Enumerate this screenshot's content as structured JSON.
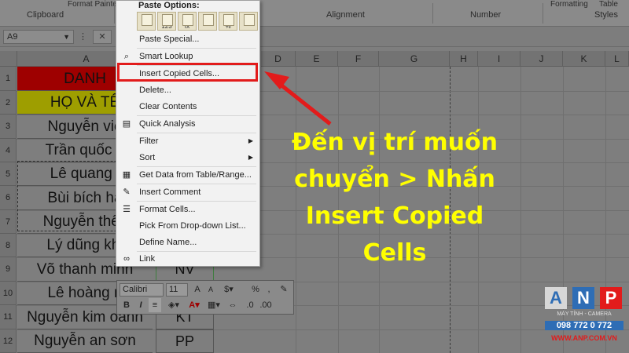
{
  "ribbon": {
    "clipboard": "Clipboard",
    "format_painter": "Format Painter",
    "alignment": "Alignment",
    "number": "Number",
    "formatting": "Formatting",
    "table": "Table",
    "styles": "Styles"
  },
  "formula_bar": {
    "name_box": "A9"
  },
  "columns": [
    "A",
    "D",
    "E",
    "F",
    "G",
    "H",
    "I",
    "J",
    "K",
    "L"
  ],
  "rows": [
    "1",
    "2",
    "3",
    "4",
    "5",
    "6",
    "7",
    "8",
    "9",
    "10",
    "11",
    "12"
  ],
  "cells_a": [
    "DANH",
    "HỌ VÀ TÊ",
    "Nguyễn việ",
    "Trần quốc b",
    "Lê quang l",
    "Bùi bích hằ",
    "Nguyễn thế l",
    "Lý dũng khi",
    "Võ thanh minh",
    "Lê hoàng n",
    "Nguyễn kim oanh",
    "Nguyễn an sơn"
  ],
  "cells_b": {
    "r9": "NV",
    "r11": "KT",
    "r12": "PP"
  },
  "context_menu": {
    "paste_options": "Paste Options:",
    "paste_icons": [
      "paste-icon",
      "paste-values-icon",
      "paste-formulas-icon",
      "paste-transpose-icon",
      "paste-formatting-icon",
      "paste-link-icon"
    ],
    "paste_icon_labels": [
      "",
      "123",
      "fx",
      "",
      "%",
      ""
    ],
    "items": [
      {
        "label": "Paste Special...",
        "icon": ""
      },
      {
        "label": "Smart Lookup",
        "icon": "search-icon"
      },
      {
        "label": "Insert Copied Cells...",
        "icon": ""
      },
      {
        "label": "Delete...",
        "icon": ""
      },
      {
        "label": "Clear Contents",
        "icon": ""
      },
      {
        "label": "Quick Analysis",
        "icon": "quick-analysis-icon"
      },
      {
        "label": "Filter",
        "icon": ""
      },
      {
        "label": "Sort",
        "icon": ""
      },
      {
        "label": "Get Data from Table/Range...",
        "icon": "table-icon"
      },
      {
        "label": "Insert Comment",
        "icon": "comment-icon"
      },
      {
        "label": "Format Cells...",
        "icon": "format-cells-icon"
      },
      {
        "label": "Pick From Drop-down List...",
        "icon": ""
      },
      {
        "label": "Define Name...",
        "icon": ""
      },
      {
        "label": "Link",
        "icon": "link-icon"
      }
    ]
  },
  "mini_toolbar": {
    "font": "Calibri",
    "size": "11",
    "bold": "B",
    "italic": "I",
    "percent": "%",
    "comma": ","
  },
  "annotation": {
    "line1": "Đến vị trí muốn",
    "line2": "chuyển > Nhấn",
    "line3": "Insert Copied",
    "line4": "Cells"
  },
  "logo": {
    "letter1": "A",
    "letter2": "N",
    "letter3": "P",
    "tagline": "MÁY TÍNH - CAMERA",
    "phone": "098 772 0 772",
    "web": "WWW.ANP.COM.VN"
  },
  "colors": {
    "highlight": "#e21b1b",
    "annotation": "#ffff00",
    "header_red": "#9e0000",
    "header_yellow": "#9e9e00"
  }
}
